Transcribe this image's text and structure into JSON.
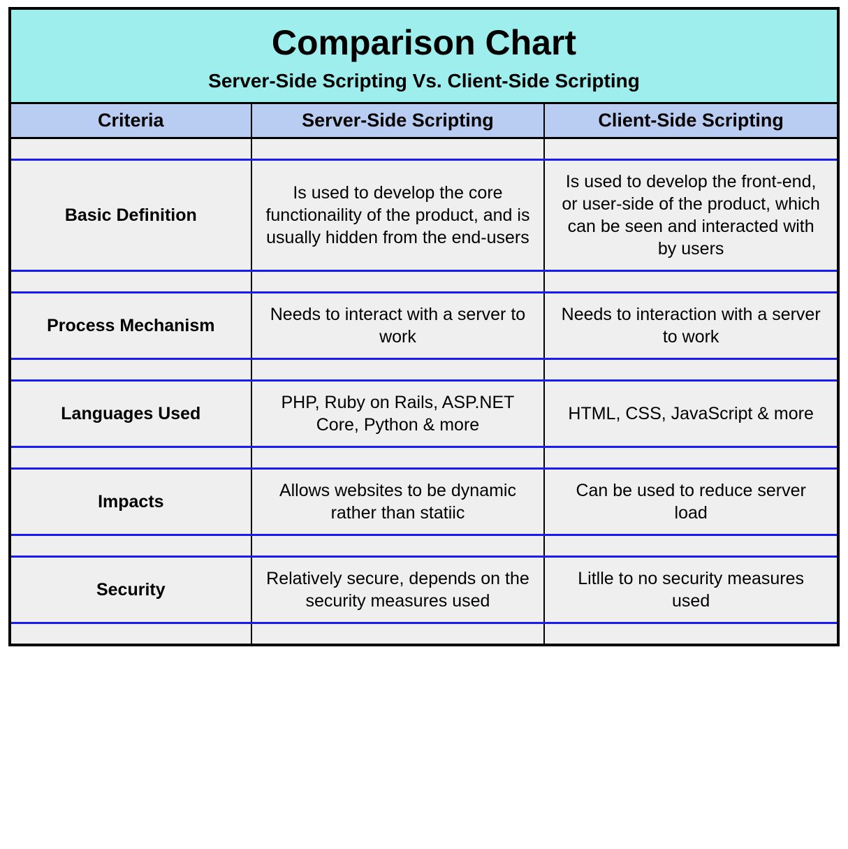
{
  "chart_data": {
    "type": "table",
    "title": "Comparison Chart",
    "subtitle": "Server-Side Scripting Vs. Client-Side Scripting",
    "columns": [
      "Criteria",
      "Server-Side Scripting",
      "Client-Side Scripting"
    ],
    "rows": [
      {
        "criteria": "Basic Definition",
        "server": "Is used to develop the core functionaility of the product, and is usually hidden from the end-users",
        "client": "Is used to develop the front-end, or user-side of the product, which can be seen and interacted with by users"
      },
      {
        "criteria": "Process Mechanism",
        "server": "Needs to interact with a server to work",
        "client": "Needs to interaction with a server to work"
      },
      {
        "criteria": "Languages Used",
        "server": "PHP, Ruby on Rails, ASP.NET Core, Python & more",
        "client": "HTML, CSS, JavaScript & more"
      },
      {
        "criteria": "Impacts",
        "server": "Allows websites to be dynamic rather than statiic",
        "client": "Can be used to reduce server load"
      },
      {
        "criteria": "Security",
        "server": "Relatively secure, depends on the security measures used",
        "client": "Litlle to no security measures used"
      }
    ]
  }
}
